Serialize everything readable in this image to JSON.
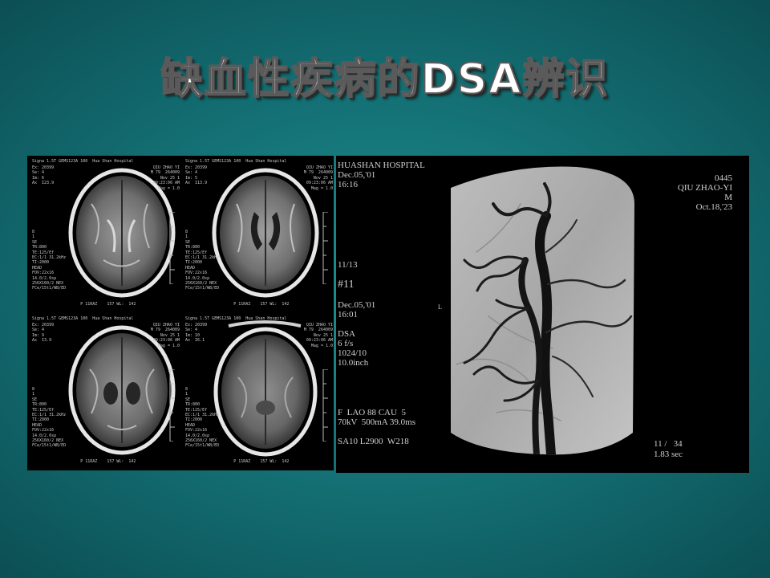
{
  "slide": {
    "title": "缺血性疾病的DSA辨识"
  },
  "mri": {
    "cells": [
      {
        "header": "Signa 1.5T GEMS123A 100  Hua Shan Hospital",
        "left": "Ex: 20399\nSe: 4\nIm: 6\nAx  I23.9",
        "right": "QIU ZHAO YI\nM 79  264009\nNov 25 1\n09:23:06 AM\nMag = 1.0",
        "seq": "8\n1\nSE\nTR:800\nTE:125/Ef\nEC:1/1 31.2kHz\nTI:2000\nHEAD\nFOV:22x16\n14.0/2.0sp\n256X160/2 NEX\nFCe/15t1/WB/ED",
        "foot": "                    P 11RAZ    157 WL:  142"
      },
      {
        "header": "Signa 1.5T GEMS123A 100  Hua Shan Hospital",
        "left": "Ex: 20399\nSe: 4\nIm: 5\nAx  I13.9",
        "right": "QIU ZHAO YI\nM 79  264009\nNov 25 1\n09:23:06 AM\nMag = 1.0",
        "seq": "8\n1\nSE\nTR:800\nTE:125/Ef\nEC:1/1 31.2kHz\nTI:2000\nHEAD\nFOV:22x16\n14.0/2.0sp\n256X160/2 NEX\nFCe/15t1/WB/ED",
        "foot": "                    P 11RAZ    157 WL:  142"
      },
      {
        "header": "Signa 1.5T GEMS123A 100  Hua Shan Hospital",
        "left": "Ex: 20399\nSe: 4\nIm: 9\nAx  I3.9",
        "right": "QIU ZHAO YI\nM 79  264009\nNov 25 1\n09:23:06 AM\nMag = 1.0",
        "seq": "8\n1\nSE\nTR:800\nTE:125/Ef\nEC:1/1 31.2kHz\nTI:2000\nHEAD\nFOV:22x16\n14.0/2.0sp\n256X160/2 NEX\nFCe/15t1/WB/ED",
        "foot": "                    P 11RAZ    157 WL:  142"
      },
      {
        "header": "Signa 1.5T GEMS123A 100  Hua Shan Hospital",
        "left": "Ex: 20399\nSe: 4\nIm: 10\nAx  I6.1",
        "right": "QIU ZHAO YI\nM 79  264009\nNov 25 1\n09:23:06 AM\nMag = 1.0",
        "seq": "8\n1\nSE\nTR:800\nTE:125/Ef\nEC:1/1 31.2kHz\nTI:2000\nHEAD\nFOV:22x16\n14.0/2.0sp\n256X160/2 NEX\nFCe/15t1/WB/ED",
        "foot": "                    P 11RAZ    157 WL:  142"
      }
    ]
  },
  "dsa": {
    "hospital": "HUASHAN HOSPITAL",
    "date": "Dec.05,'01",
    "time": "16:16",
    "patient_id": "0445",
    "patient_name": "QIU ZHAO-YI",
    "sex": "M",
    "birth": "Oct.18,'23",
    "series_ratio": "11/13",
    "series_no": "#11",
    "date2": "Dec.05,'01",
    "time2": "16:01",
    "mode": "DSA",
    "rate": "6 f/s",
    "matrix": "1024/10",
    "field": "10.0inch",
    "orientation": "L",
    "angle": "F  LAO 88 CAU  5",
    "exposure": "70kV  500mA 39.0ms",
    "window": "SA10 L2900  W218",
    "frame": "11 /   34",
    "elapsed": "1.83 sec"
  }
}
